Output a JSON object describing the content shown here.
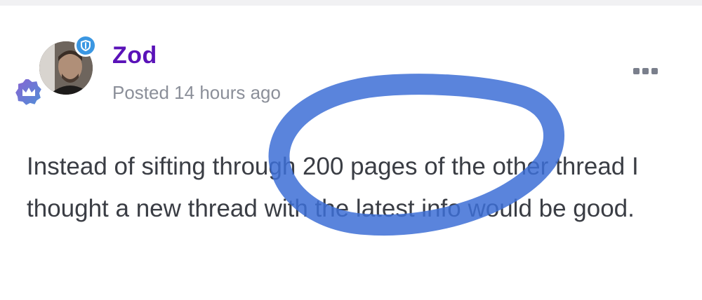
{
  "post": {
    "author": "Zod",
    "posted": "Posted 14 hours ago",
    "body": "Instead of sifting through 200 pages of the other thread I thought a new thread with the latest info would be good."
  },
  "icons": {
    "shield_badge": "shield-icon",
    "rank_badge": "crown-icon",
    "more": "more-options-icon"
  },
  "colors": {
    "author": "#5a12b8",
    "shield_badge": "#3b97e2",
    "rank_badge": "#6d5bd0",
    "annotation": "#3d6fd6"
  }
}
